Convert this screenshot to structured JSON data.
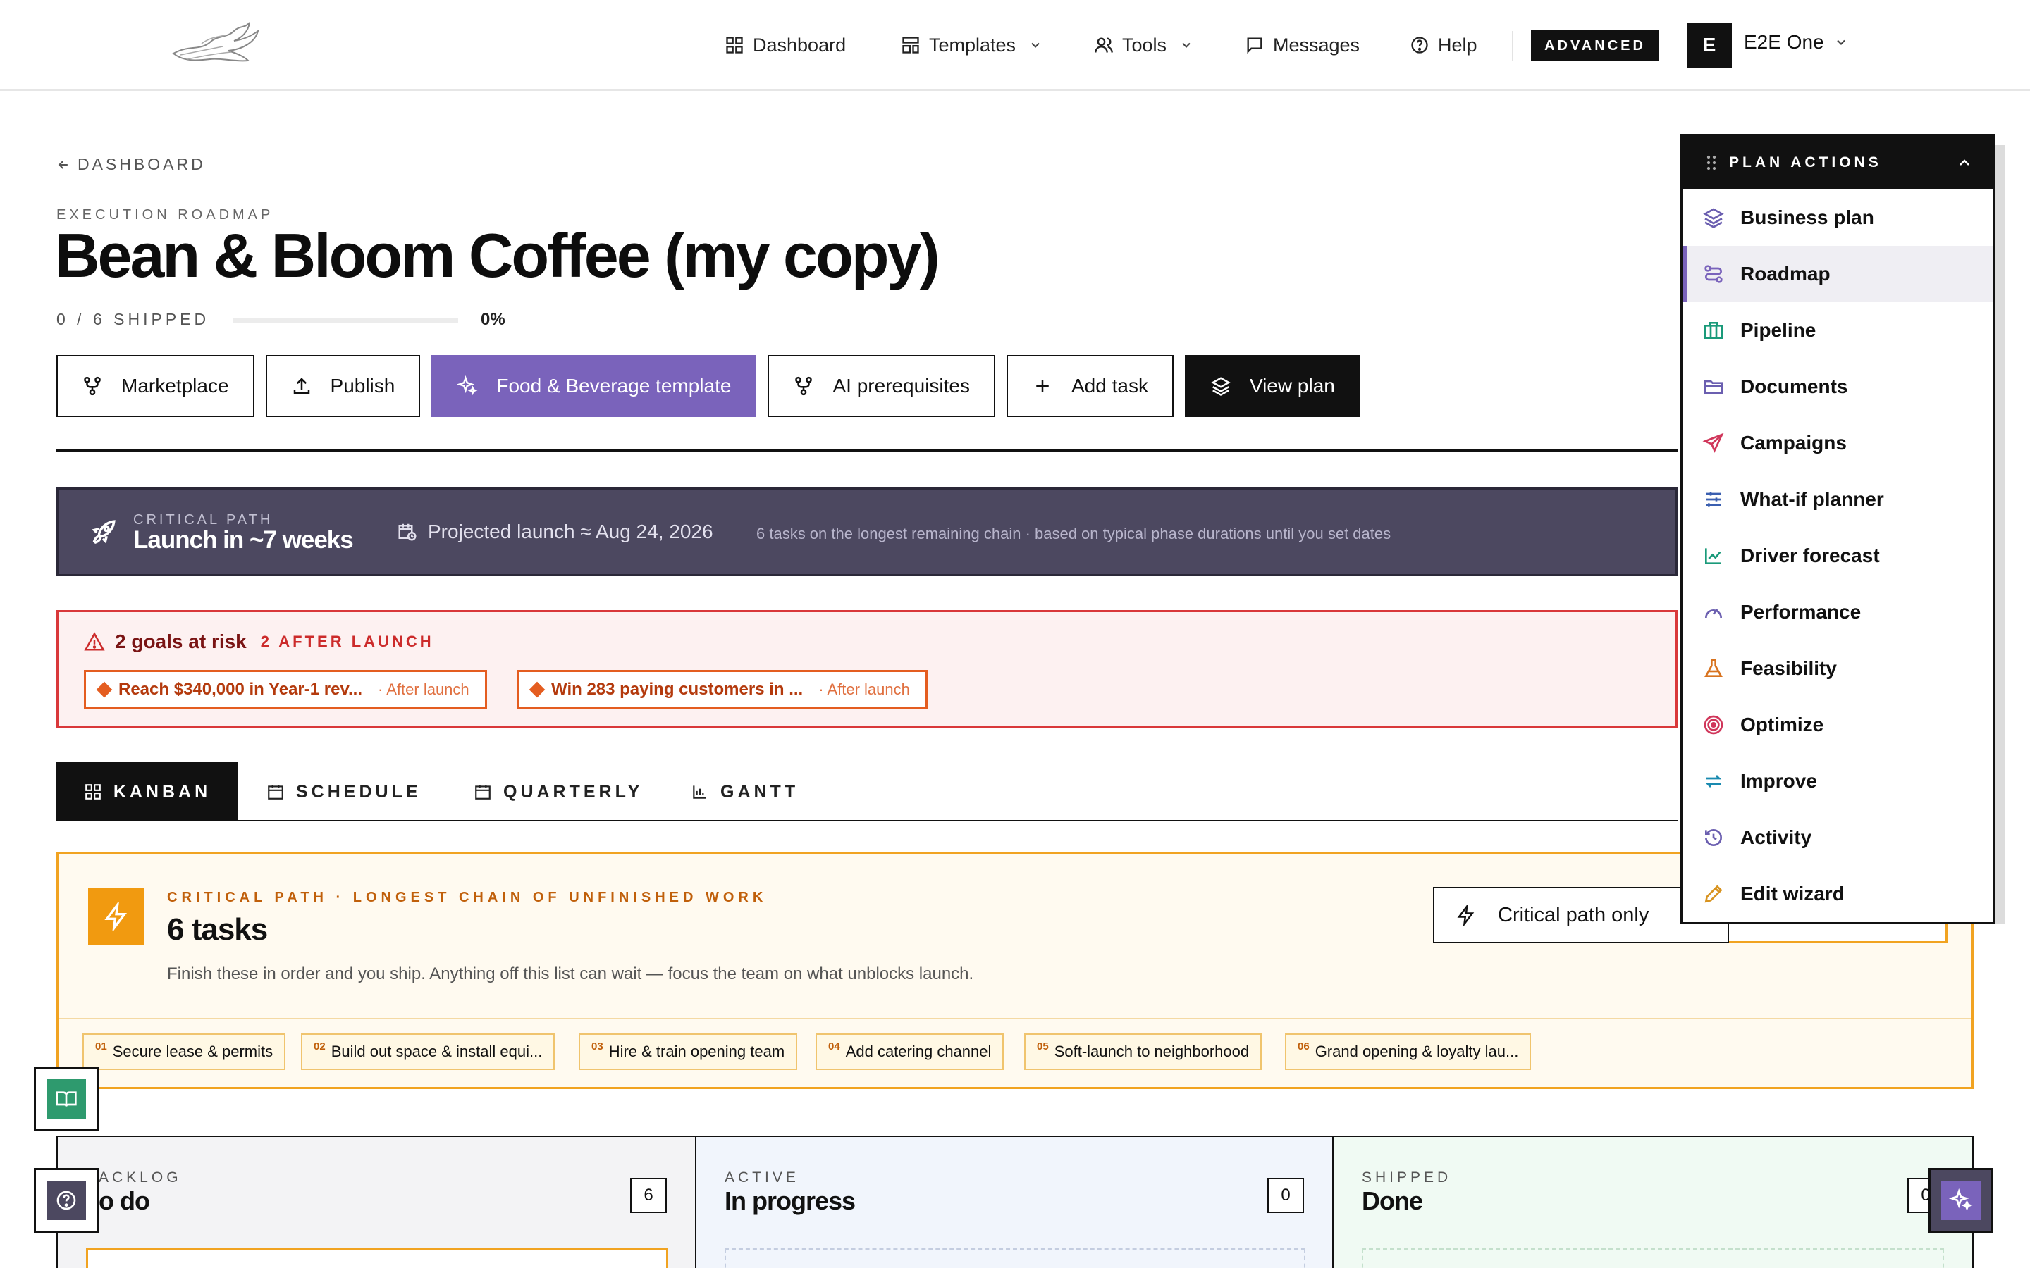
{
  "nav": {
    "items": [
      {
        "label": "Dashboard",
        "icon": "grid-icon"
      },
      {
        "label": "Templates",
        "icon": "layout-icon"
      },
      {
        "label": "Tools",
        "icon": "users-icon"
      },
      {
        "label": "Messages",
        "icon": "message-icon"
      },
      {
        "label": "Help",
        "icon": "help-circle-icon"
      }
    ],
    "advanced": "ADVANCED",
    "avatar_initial": "E",
    "user_name": "E2E One"
  },
  "header": {
    "back": "DASHBOARD",
    "eyebrow": "EXECUTION ROADMAP",
    "title": "Bean & Bloom Coffee (my copy)",
    "shipped": "0 / 6 SHIPPED",
    "progress_pct": "0%",
    "progress_value": 0
  },
  "buttons": {
    "marketplace": "Marketplace",
    "publish": "Publish",
    "template": "Food & Beverage template",
    "ai_prereq": "AI prerequisites",
    "add_task": "Add task",
    "view_plan": "View plan"
  },
  "critical_banner": {
    "label": "CRITICAL PATH",
    "title": "Launch in ~7 weeks",
    "projected": "Projected launch ≈ Aug 24, 2026",
    "note": "6 tasks on the longest remaining chain · based on typical phase durations until you set dates"
  },
  "risk": {
    "title": "2 goals at risk",
    "after": "2 AFTER LAUNCH",
    "goals": [
      {
        "goal": "Reach $340,000 in Year-1 rev...",
        "when": "· After launch"
      },
      {
        "goal": "Win 283 paying customers in ...",
        "when": "· After launch"
      }
    ]
  },
  "tabs": [
    "KANBAN",
    "SCHEDULE",
    "QUARTERLY",
    "GANTT"
  ],
  "critical_path": {
    "eyebrow": "CRITICAL PATH · LONGEST CHAIN OF UNFINISHED WORK",
    "title": "6 tasks",
    "desc": "Finish these in order and you ship. Anything off this list can wait — focus the team on what unblocks launch.",
    "toggle": "Critical path only",
    "steps": [
      {
        "n": "01",
        "label": "Secure lease & permits"
      },
      {
        "n": "02",
        "label": "Build out space & install equi..."
      },
      {
        "n": "03",
        "label": "Hire & train opening team"
      },
      {
        "n": "04",
        "label": "Add catering channel"
      },
      {
        "n": "05",
        "label": "Soft-launch to neighborhood"
      },
      {
        "n": "06",
        "label": "Grand opening & loyalty lau..."
      }
    ]
  },
  "kanban": {
    "columns": [
      {
        "label": "ACKLOG",
        "title": "o do",
        "count": "6"
      },
      {
        "label": "ACTIVE",
        "title": "In progress",
        "count": "0"
      },
      {
        "label": "SHIPPED",
        "title": "Done",
        "count": "0"
      }
    ]
  },
  "plan_actions": {
    "title": "PLAN ACTIONS",
    "items": [
      {
        "label": "Business plan",
        "icon": "layers-icon",
        "color": "#6b5fb0"
      },
      {
        "label": "Roadmap",
        "icon": "route-icon",
        "color": "#7a63bb"
      },
      {
        "label": "Pipeline",
        "icon": "briefcase-icon",
        "color": "#1a9a7a"
      },
      {
        "label": "Documents",
        "icon": "folder-icon",
        "color": "#6b5fb0"
      },
      {
        "label": "Campaigns",
        "icon": "send-icon",
        "color": "#d0365a"
      },
      {
        "label": "What-if planner",
        "icon": "sliders-icon",
        "color": "#3a5fb0"
      },
      {
        "label": "Driver forecast",
        "icon": "line-chart-icon",
        "color": "#1a9a7a"
      },
      {
        "label": "Performance",
        "icon": "gauge-icon",
        "color": "#6b5fb0"
      },
      {
        "label": "Feasibility",
        "icon": "flask-icon",
        "color": "#d8731f"
      },
      {
        "label": "Optimize",
        "icon": "target-icon",
        "color": "#d0365a"
      },
      {
        "label": "Improve",
        "icon": "refresh-icon",
        "color": "#1a8ab0"
      },
      {
        "label": "Activity",
        "icon": "history-icon",
        "color": "#6b5fb0"
      },
      {
        "label": "Edit wizard",
        "icon": "pencil-icon",
        "color": "#d8931f"
      }
    ]
  },
  "colors": {
    "accent": "#7a63bb",
    "warning": "#f1a321",
    "danger": "#d9383a",
    "banner": "#4c4860"
  }
}
